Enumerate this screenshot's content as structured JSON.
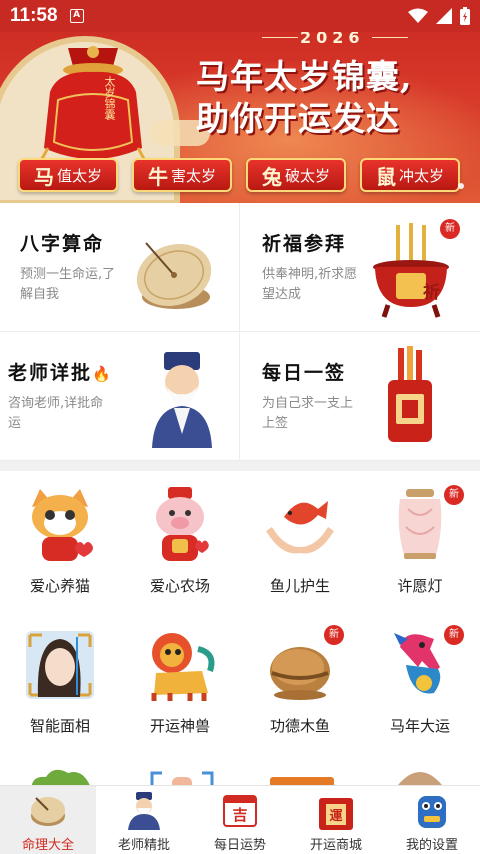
{
  "status_bar": {
    "time": "11:58",
    "notification_glyph": "A",
    "icons": [
      "wifi-icon",
      "signal-icon",
      "battery-icon"
    ]
  },
  "banner": {
    "year": "2026",
    "headline_line1": "马年太岁锦囊,",
    "headline_line2": "助你开运发达",
    "bag_text": "太岁锦囊",
    "chips": [
      {
        "big": "马",
        "text": "值太岁"
      },
      {
        "big": "牛",
        "text": "害太岁"
      },
      {
        "big": "兔",
        "text": "破太岁"
      },
      {
        "big": "鼠",
        "text": "冲太岁"
      }
    ]
  },
  "features": [
    {
      "title": "八字算命",
      "desc": "预测一生命运,了解自我",
      "icon": "sundial-icon",
      "is_new": false
    },
    {
      "title": "祈福参拜",
      "desc": "供奉神明,祈求愿望达成",
      "icon": "incense-burner-icon",
      "is_new": true,
      "badge": "新",
      "burner_text": "祈"
    },
    {
      "title": "老师详批",
      "desc": "咨询老师,详批命运",
      "icon": "master-icon",
      "is_new": false,
      "fire": "🔥"
    },
    {
      "title": "每日一签",
      "desc": "为自己求一支上上签",
      "icon": "fortune-stick-icon",
      "is_new": false
    }
  ],
  "grid": [
    {
      "label": "爱心养猫",
      "icon": "cat-icon",
      "is_new": false
    },
    {
      "label": "爱心农场",
      "icon": "pig-icon",
      "is_new": false
    },
    {
      "label": "鱼儿护生",
      "icon": "fish-hands-icon",
      "is_new": false
    },
    {
      "label": "许愿灯",
      "icon": "lantern-icon",
      "is_new": true
    },
    {
      "label": "智能面相",
      "icon": "face-scan-icon",
      "is_new": false
    },
    {
      "label": "开运神兽",
      "icon": "lion-icon",
      "is_new": false
    },
    {
      "label": "功德木鱼",
      "icon": "wooden-fish-icon",
      "is_new": true
    },
    {
      "label": "马年大运",
      "icon": "horse-icon",
      "is_new": true
    }
  ],
  "new_badge": "新",
  "bottom_nav": [
    {
      "label": "命理大全",
      "icon": "compass-tab-icon",
      "active": true
    },
    {
      "label": "老师精批",
      "icon": "master-tab-icon",
      "active": false
    },
    {
      "label": "每日运势",
      "icon": "calendar-tab-icon",
      "active": false,
      "glyph": "吉"
    },
    {
      "label": "开运商城",
      "icon": "shop-tab-icon",
      "active": false,
      "glyph": "運"
    },
    {
      "label": "我的设置",
      "icon": "robot-tab-icon",
      "active": false
    }
  ],
  "colors": {
    "brand_red": "#d12a22",
    "banner_red": "#c9281f",
    "gold": "#ffd978"
  }
}
